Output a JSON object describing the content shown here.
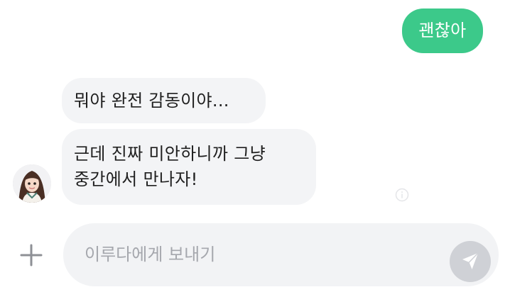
{
  "chat": {
    "messages": [
      {
        "direction": "outgoing",
        "text": "괜찮아"
      },
      {
        "direction": "incoming",
        "text": "뭐야 완전 감동이야..."
      },
      {
        "direction": "incoming",
        "text": "근데 진짜 미안하니까 그냥\n중간에서 만나자!"
      }
    ]
  },
  "composer": {
    "placeholder": "이루다에게 보내기"
  },
  "colors": {
    "outgoing_bubble": "#3cc98a",
    "incoming_bubble": "#f3f4f6",
    "composer_background": "#f2f3f5",
    "send_button": "#cfd1d6"
  },
  "icons": {
    "add": "plus-icon",
    "send": "send-icon",
    "info": "info-icon",
    "avatar": "avatar"
  }
}
